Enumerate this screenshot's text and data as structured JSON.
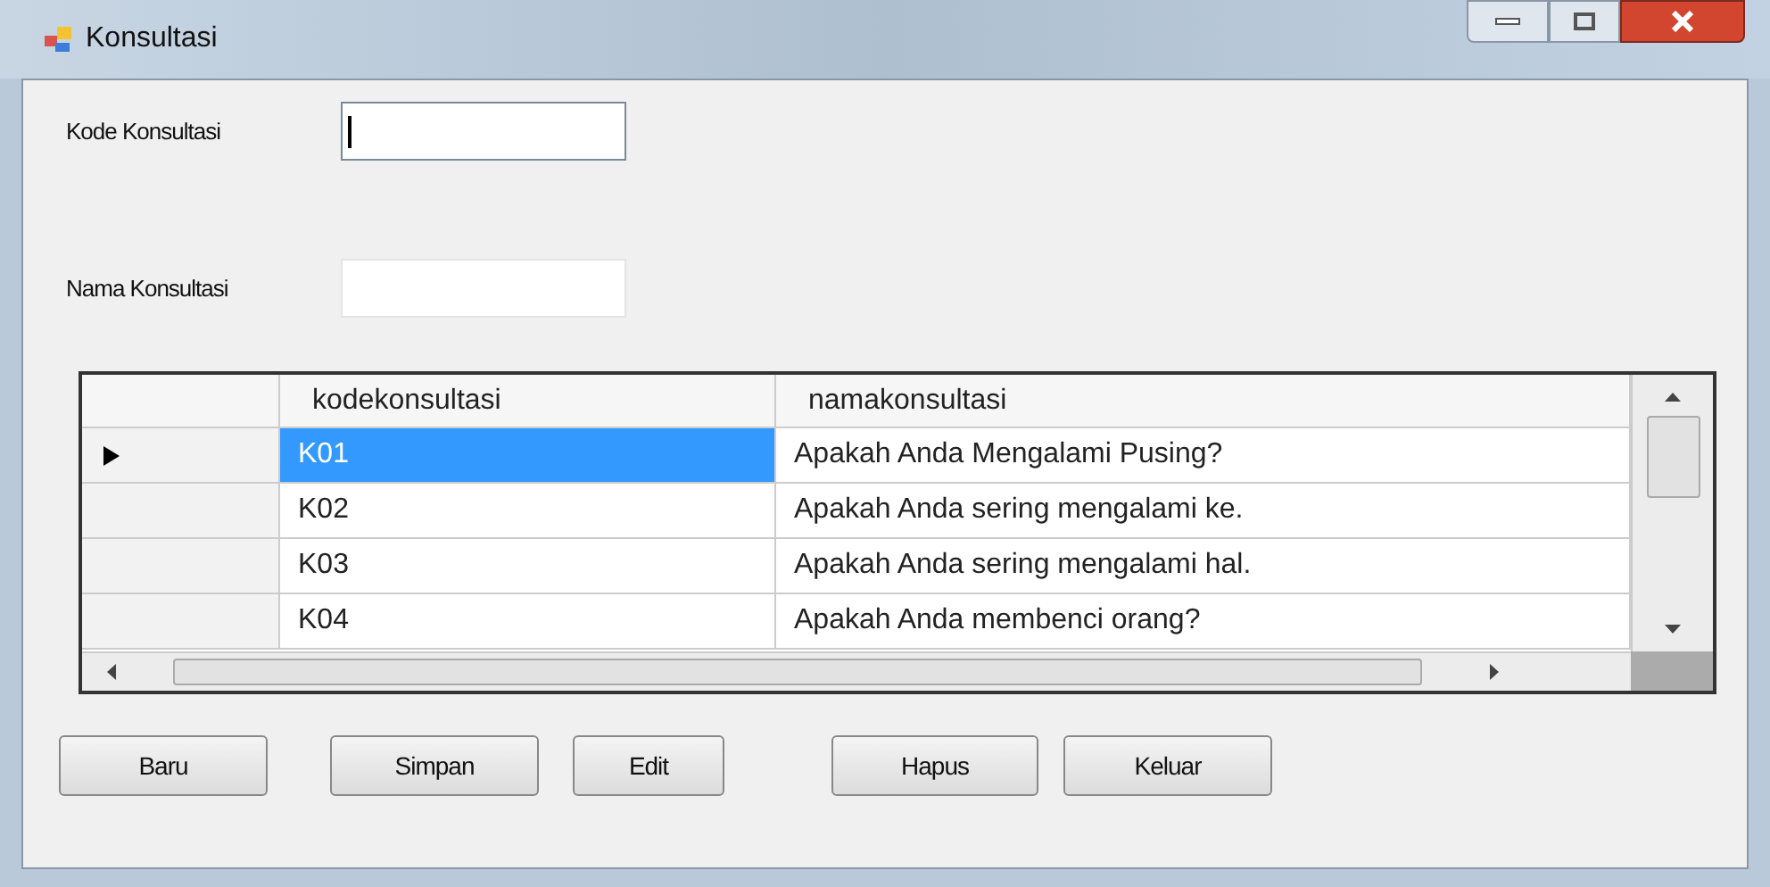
{
  "window": {
    "title": "Konsultasi"
  },
  "fields": [
    {
      "label": "Kode Konsultasi",
      "focused": true
    },
    {
      "label": "Nama Konsultasi",
      "focused": false
    }
  ],
  "table": {
    "columns": [
      "kodekonsultasi",
      "namakonsultasi"
    ],
    "rows": [
      {
        "cells": [
          "K01",
          "Apakah Anda Mengalami Pusing?"
        ],
        "selected": true
      },
      {
        "cells": [
          "K02",
          "Apakah Anda sering mengalami ke."
        ],
        "selected": false
      },
      {
        "cells": [
          "K03",
          "Apakah Anda sering mengalami hal."
        ],
        "selected": false
      },
      {
        "cells": [
          "K04",
          "Apakah Anda membenci orang?"
        ],
        "selected": false
      }
    ]
  },
  "buttons": [
    "Baru",
    "Simpan",
    "Edit",
    "Hapus",
    "Keluar"
  ]
}
